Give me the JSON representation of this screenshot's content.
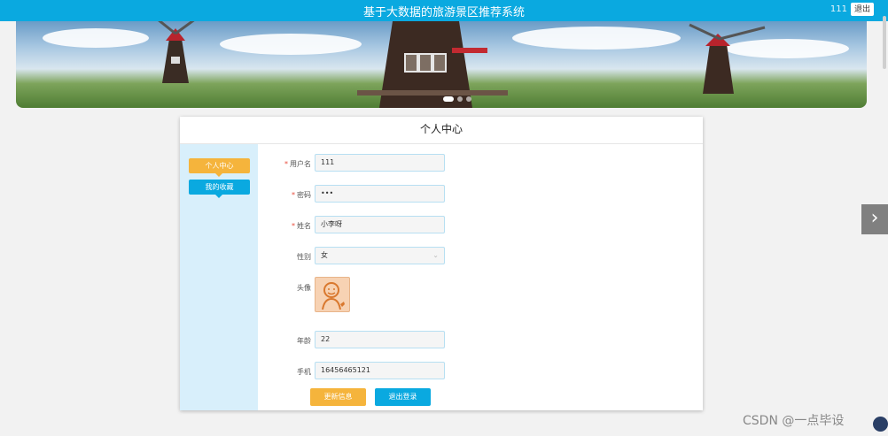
{
  "header": {
    "title": "基于大数据的旅游景区推荐系统",
    "username": "111",
    "logout_label": "退出"
  },
  "carousel": {
    "slide_count": 3,
    "active_index": 0,
    "next_icon": "chevron-right-icon"
  },
  "profile": {
    "title": "个人中心",
    "sidebar": {
      "items": [
        {
          "label": "个人中心",
          "color": "#f5b43c"
        },
        {
          "label": "我的收藏",
          "color": "#0aa9e0"
        }
      ]
    },
    "fields": {
      "username": {
        "label": "用户名",
        "required": "*",
        "value": "111"
      },
      "password": {
        "label": "密码",
        "required": "*",
        "value": "•••"
      },
      "name": {
        "label": "姓名",
        "required": "*",
        "value": "小李呀"
      },
      "gender": {
        "label": "性别",
        "value": "女"
      },
      "avatar": {
        "label": "头像",
        "icon": "avatar-image"
      },
      "age": {
        "label": "年龄",
        "value": "22"
      },
      "phone": {
        "label": "手机",
        "value": "16456465121"
      }
    },
    "buttons": {
      "update_label": "更新信息",
      "logout_label": "退出登录"
    }
  },
  "watermark": "CSDN @一点毕设",
  "colors": {
    "primary": "#0aa9e0",
    "accent": "#f5b43c",
    "sidebar_bg": "#d8effb",
    "required": "#e74c3c"
  }
}
